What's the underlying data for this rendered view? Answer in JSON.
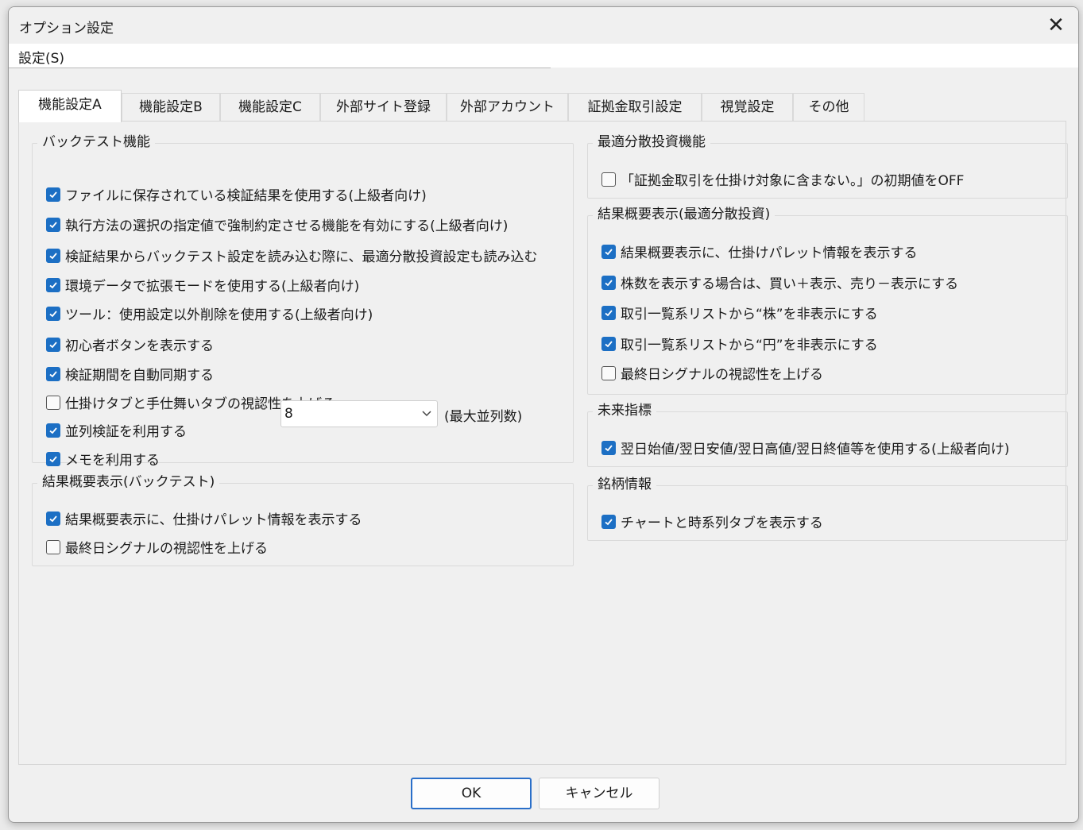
{
  "window": {
    "title": "オプション設定"
  },
  "menubar": {
    "settings": "設定(S)"
  },
  "tabs": [
    "機能設定A",
    "機能設定B",
    "機能設定C",
    "外部サイト登録",
    "外部アカウント",
    "証拠金取引設定",
    "視覚設定",
    "その他"
  ],
  "active_tab": "機能設定A",
  "backtest": {
    "title": "バックテスト機能",
    "items": [
      {
        "label": "ファイルに保存されている検証結果を使用する(上級者向け)",
        "checked": true
      },
      {
        "label": "執行方法の選択の指定値で強制約定させる機能を有効にする(上級者向け)",
        "checked": true
      },
      {
        "label": "検証結果からバックテスト設定を読み込む際に、最適分散投資設定も読み込む",
        "checked": true
      },
      {
        "label": "環境データで拡張モードを使用する(上級者向け)",
        "checked": true
      },
      {
        "label": "ツール：使用設定以外削除を使用する(上級者向け)",
        "checked": true
      },
      {
        "label": "初心者ボタンを表示する",
        "checked": true
      },
      {
        "label": "検証期間を自動同期する",
        "checked": true
      },
      {
        "label": "仕掛けタブと手仕舞いタブの視認性を上げる",
        "checked": false
      },
      {
        "label": "並列検証を利用する",
        "checked": true
      },
      {
        "label": "メモを利用する",
        "checked": true
      }
    ],
    "parallel_select": {
      "value": "8",
      "suffix": "(最大並列数)"
    }
  },
  "summary_backtest": {
    "title": "結果概要表示(バックテスト)",
    "items": [
      {
        "label": "結果概要表示に、仕掛けパレット情報を表示する",
        "checked": true
      },
      {
        "label": "最終日シグナルの視認性を上げる",
        "checked": false
      }
    ]
  },
  "optimal": {
    "title": "最適分散投資機能",
    "items": [
      {
        "label": "「証拠金取引を仕掛け対象に含まない。」の初期値をOFF",
        "checked": false
      }
    ]
  },
  "summary_optimal": {
    "title": "結果概要表示(最適分散投資)",
    "items": [
      {
        "label": "結果概要表示に、仕掛けパレット情報を表示する",
        "checked": true
      },
      {
        "label": "株数を表示する場合は、買い＋表示、売り－表示にする",
        "checked": true
      },
      {
        "label": "取引一覧系リストから“株”を非表示にする",
        "checked": true
      },
      {
        "label": "取引一覧系リストから“円”を非表示にする",
        "checked": true
      },
      {
        "label": "最終日シグナルの視認性を上げる",
        "checked": false
      }
    ]
  },
  "future": {
    "title": "未来指標",
    "items": [
      {
        "label": "翌日始値/翌日安値/翌日高値/翌日終値等を使用する(上級者向け)",
        "checked": true
      }
    ]
  },
  "stock_info": {
    "title": "銘柄情報",
    "items": [
      {
        "label": "チャートと時系列タブを表示する",
        "checked": true
      }
    ]
  },
  "buttons": {
    "ok": "OK",
    "cancel": "キャンセル"
  },
  "colors": {
    "accent": "#1c6fc4",
    "window_bg": "#f0f0f0"
  }
}
